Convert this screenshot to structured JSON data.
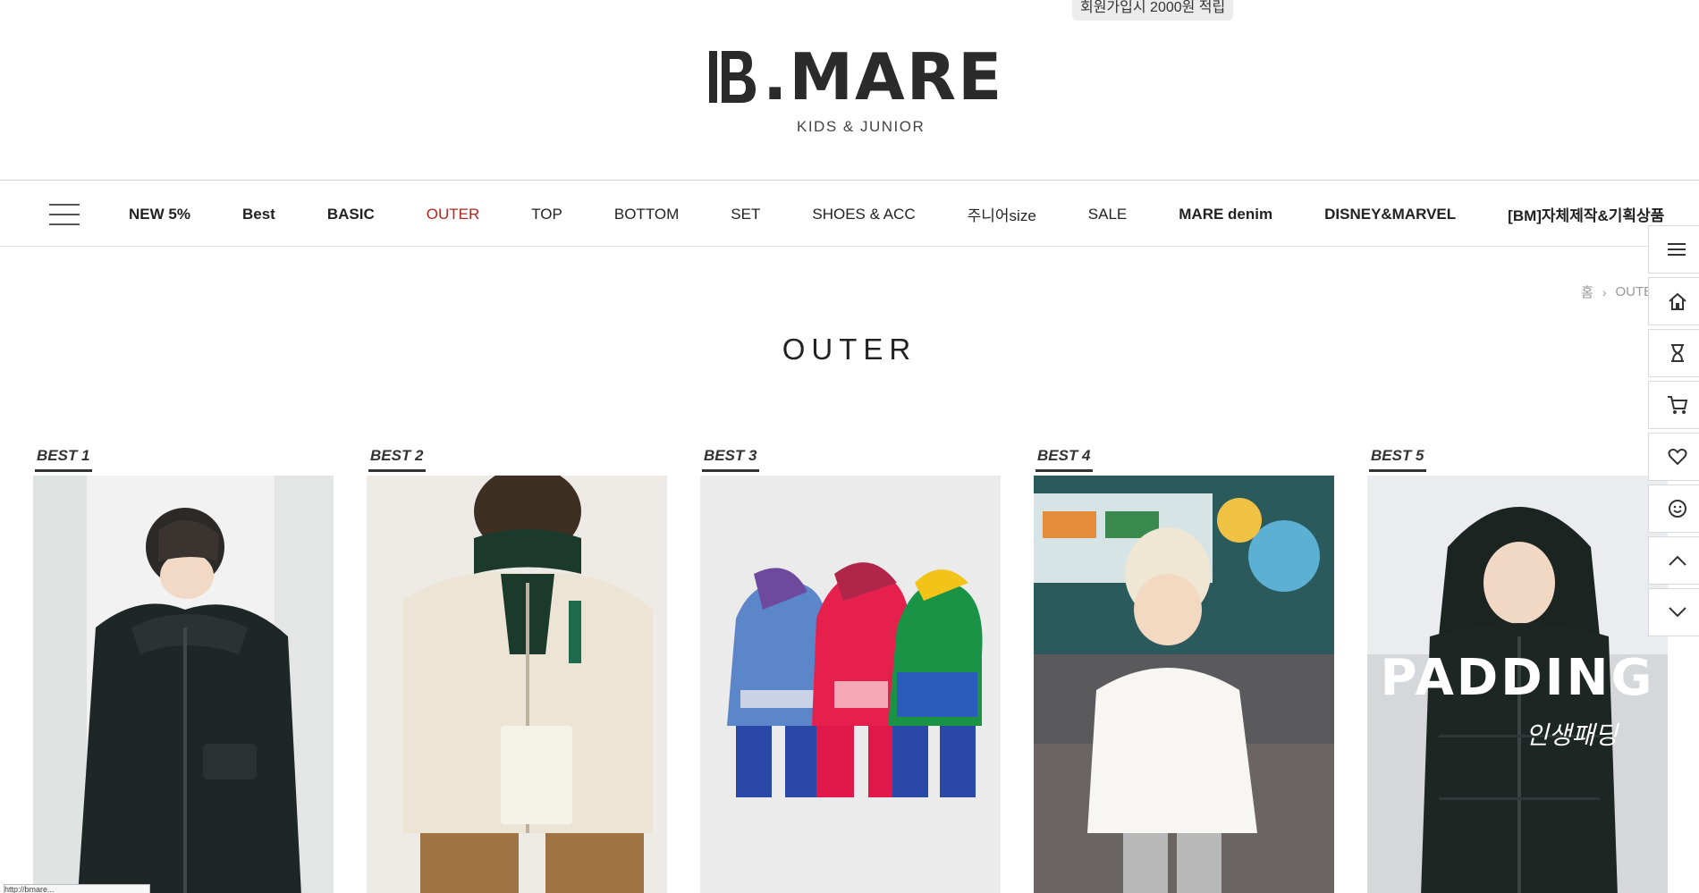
{
  "promo_text": "회원가입시 2000원 적립",
  "brand": {
    "name": ".MARE",
    "tagline": "KIDS & JUNIOR",
    "color": "#2b2b2b"
  },
  "nav": {
    "items": [
      {
        "label": "NEW 5%"
      },
      {
        "label": "Best"
      },
      {
        "label": "BASIC"
      },
      {
        "label": "OUTER"
      },
      {
        "label": "TOP"
      },
      {
        "label": "BOTTOM"
      },
      {
        "label": "SET"
      },
      {
        "label": "SHOES & ACC"
      },
      {
        "label": "주니어size"
      },
      {
        "label": "SALE"
      },
      {
        "label": "MARE denim"
      },
      {
        "label": "DISNEY&MARVEL"
      },
      {
        "label": "[BM]자체제작&기획상품"
      }
    ],
    "active_color": "#b3251f"
  },
  "breadcrumb": {
    "home": "홈",
    "current": "OUTER"
  },
  "page_title": "OUTER",
  "products": [
    {
      "label": "BEST 1"
    },
    {
      "label": "BEST 2"
    },
    {
      "label": "BEST 3"
    },
    {
      "label": "BEST 4"
    },
    {
      "label": "BEST 5",
      "overlay_title": "PADDING",
      "overlay_sub": "인생패딩"
    }
  ],
  "quick_bar": [
    "menu-icon",
    "home-icon",
    "hourglass-icon",
    "cart-icon",
    "heart-icon",
    "smile-icon",
    "chevron-up-icon",
    "chevron-down-icon"
  ],
  "status_text": "http://bmare..."
}
